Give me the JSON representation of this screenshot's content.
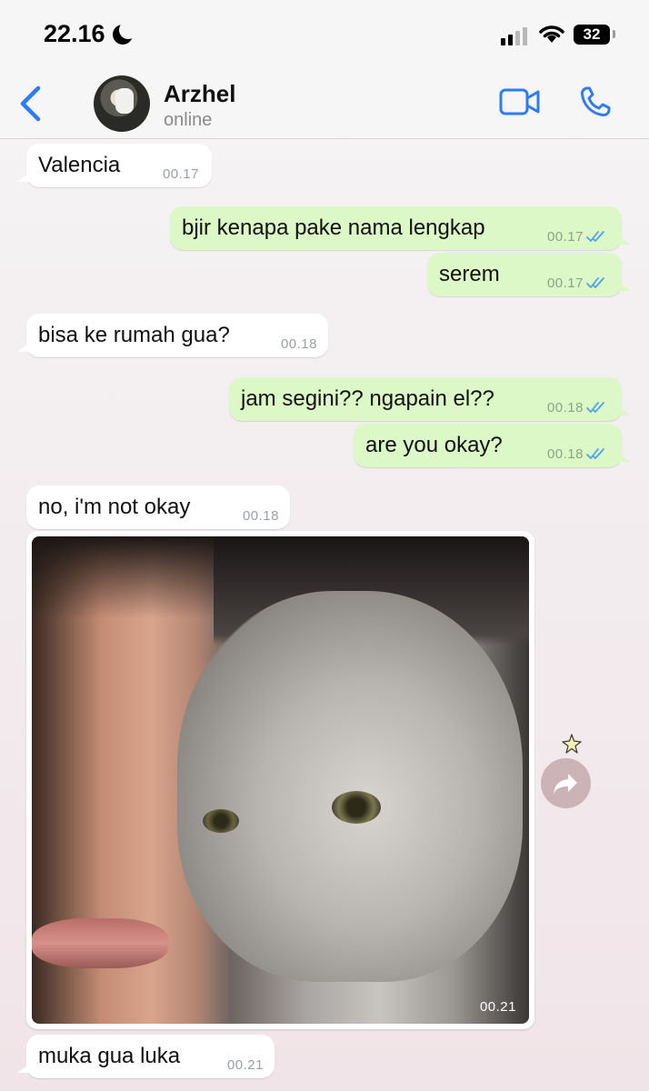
{
  "status_bar": {
    "time": "22.16",
    "battery": "32"
  },
  "header": {
    "contact_name": "Arzhel",
    "contact_status": "online"
  },
  "messages": [
    {
      "direction": "in",
      "text": "Valencia",
      "time": "00.17"
    },
    {
      "direction": "out",
      "text": "bjir kenapa pake nama lengkap",
      "time": "00.17",
      "read": true
    },
    {
      "direction": "out",
      "text": "serem",
      "time": "00.17",
      "read": true
    },
    {
      "direction": "in",
      "text": "bisa ke rumah gua?",
      "time": "00.18"
    },
    {
      "direction": "out",
      "text": "jam segini?? ngapain el??",
      "time": "00.18",
      "read": true
    },
    {
      "direction": "out",
      "text": "are you okay?",
      "time": "00.18",
      "read": true
    },
    {
      "direction": "in",
      "text": "no, i'm not okay",
      "time": "00.18"
    },
    {
      "direction": "in",
      "type": "image",
      "time": "00.21"
    },
    {
      "direction": "in",
      "text": "muka gua luka",
      "time": "00.21"
    }
  ],
  "colors": {
    "accent": "#2f7bf6",
    "outgoing_bubble": "#dcf8c6",
    "incoming_bubble": "#ffffff",
    "read_ticks": "#4fa3e8"
  },
  "icons": [
    "moon-icon",
    "signal-icon",
    "wifi-icon",
    "battery-icon",
    "back-chevron-icon",
    "video-call-icon",
    "phone-call-icon",
    "double-check-icon",
    "forward-icon",
    "sparkle-icon"
  ]
}
